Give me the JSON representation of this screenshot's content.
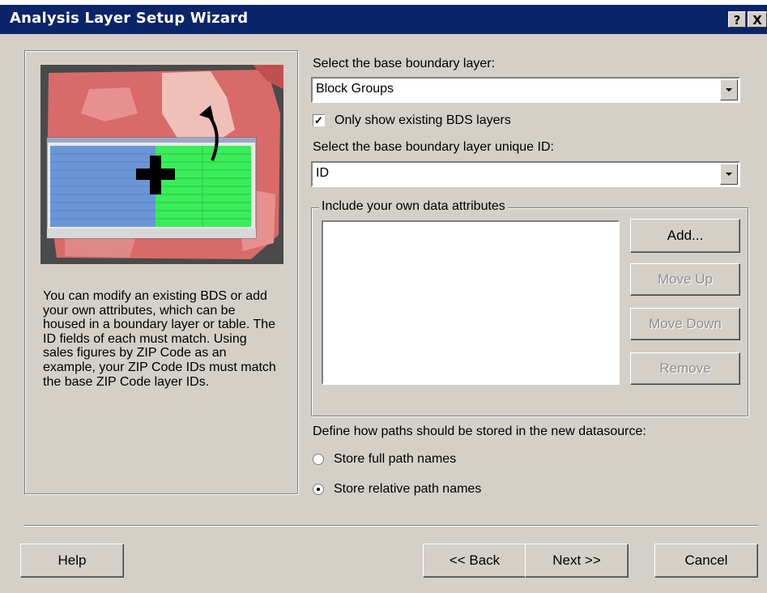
{
  "window": {
    "title": "Analysis Layer Setup Wizard",
    "help_glyph": "?",
    "close_glyph": "X"
  },
  "illustration": {
    "icon": "map-and-table-merge-illustration",
    "colors": {
      "map": "#e07070",
      "table_blue": "#6a96d8",
      "table_green": "#3aee5a"
    }
  },
  "left_panel": {
    "description": "You can modify an existing BDS or add your own attributes, which can be housed in a boundary layer or table. The ID fields of each must match. Using sales figures by ZIP Code as an example, your ZIP Code IDs must match the base ZIP Code layer IDs."
  },
  "form": {
    "base_layer_label": "Select the base boundary layer:",
    "base_layer_value": "Block Groups",
    "only_existing_label": "Only show existing BDS layers",
    "only_existing_checked": true,
    "unique_id_label": "Select the base boundary layer unique ID:",
    "unique_id_value": "ID",
    "attributes_group_label": "Include your own data attributes",
    "attributes_list": [],
    "buttons": {
      "add": "Add...",
      "move_up": "Move Up",
      "move_down": "Move Down",
      "remove": "Remove"
    },
    "paths_label": "Define how paths should be stored in the new datasource:",
    "path_options": [
      {
        "label": "Store full path names",
        "selected": false
      },
      {
        "label": "Store relative path names",
        "selected": true
      }
    ]
  },
  "footer": {
    "help": "Help",
    "back": "<< Back",
    "next": "Next >>",
    "cancel": "Cancel"
  }
}
